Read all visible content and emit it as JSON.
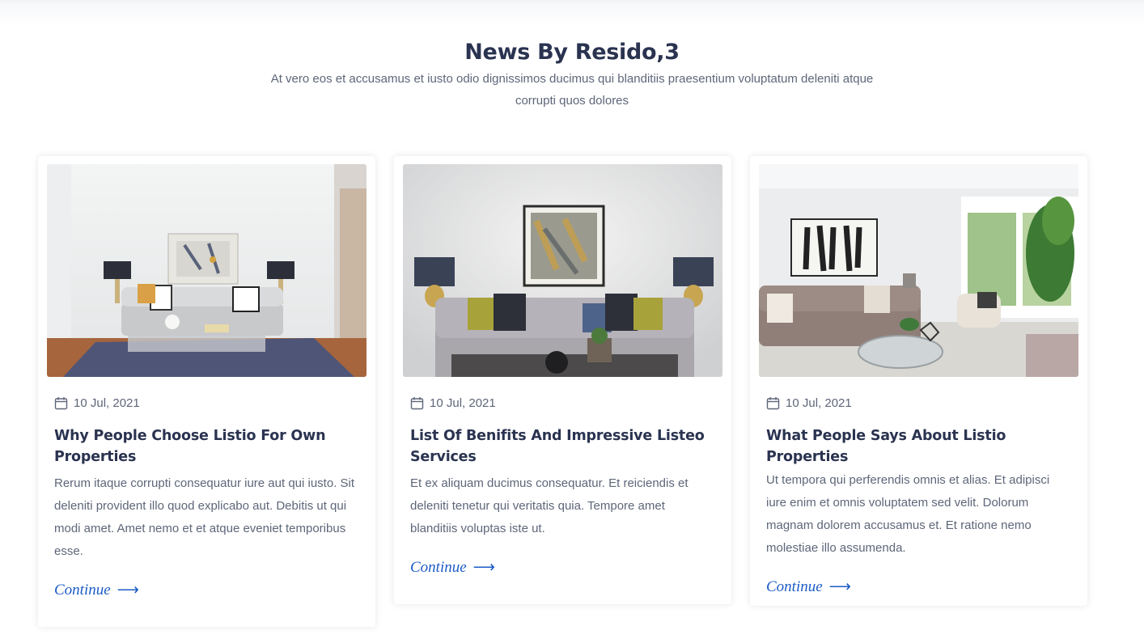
{
  "section": {
    "title": "News By Resido,3",
    "subtitle": "At vero eos et accusamus et iusto odio dignissimos ducimus qui blanditiis praesentium voluptatum deleniti atque corrupti quos dolores"
  },
  "cards": [
    {
      "image_alt": "Bright living room with grey sofa, two lamps and abstract painting",
      "date": "10 Jul, 2021",
      "title": "Why People Choose Listio For Own Properties",
      "text": "Rerum itaque corrupti consequatur iure aut qui iusto. Sit deleniti provident illo quod explicabo aut. Debitis ut qui modi amet. Amet nemo et et atque eveniet temporibus esse.",
      "link": "Continue"
    },
    {
      "image_alt": "Tufted grey sofa with patterned cushions, lamps and abstract painting",
      "date": "10 Jul, 2021",
      "title": "List Of Benifits And Impressive Listeo Services",
      "text": "Et ex aliquam ducimus consequatur. Et reiciendis et deleniti tenetur qui veritatis quia. Tempore amet blanditiis voluptas iste ut.",
      "link": "Continue"
    },
    {
      "image_alt": "Sunny living room with brown sofa, glass table and plant by window",
      "date": "10 Jul, 2021",
      "title": "What People Says About Listio Properties",
      "text": "Ut tempora qui perferendis omnis et alias. Et adipisci iure enim et omnis voluptatem sed velit. Dolorum magnam dolorem accusamus et. Et ratione nemo molestiae illo assumenda.",
      "link": "Continue"
    }
  ],
  "icons": {
    "date": "calendar-icon",
    "link": "long-arrow-right-icon"
  },
  "colors": {
    "heading": "#2a3350",
    "text": "#5e6679",
    "link": "#1b5bc6",
    "card_background": "#ffffff"
  }
}
